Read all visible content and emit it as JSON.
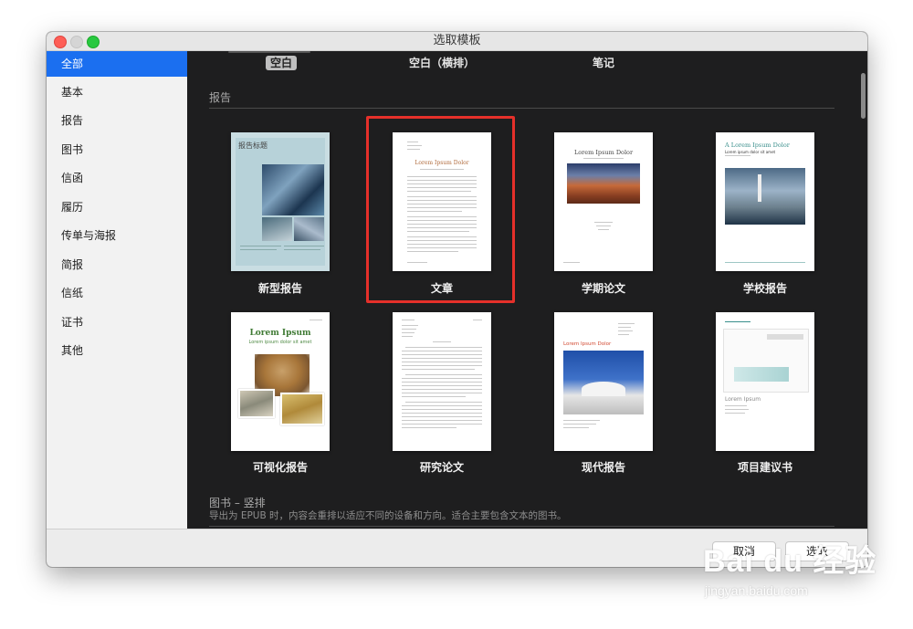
{
  "window": {
    "title": "选取模板"
  },
  "sidebar": {
    "items": [
      {
        "label": "全部",
        "active": true
      },
      {
        "label": "基本"
      },
      {
        "label": "报告"
      },
      {
        "label": "图书"
      },
      {
        "label": "信函"
      },
      {
        "label": "履历"
      },
      {
        "label": "传单与海报"
      },
      {
        "label": "简报"
      },
      {
        "label": "信纸"
      },
      {
        "label": "证书"
      },
      {
        "label": "其他"
      }
    ]
  },
  "top_templates": [
    {
      "label": "空白",
      "selected": true
    },
    {
      "label": "空白（横排）"
    },
    {
      "label": "笔记"
    }
  ],
  "sections": {
    "report": {
      "title": "报告"
    },
    "book_vertical": {
      "title": "图书 – 竖排",
      "description": "导出为 EPUB 时，内容会重排以适应不同的设备和方向。适合主要包含文本的图书。"
    }
  },
  "templates": [
    {
      "label": "新型报告",
      "thumb_title": "报告标题"
    },
    {
      "label": "文章",
      "thumb_title": "Lorem Ipsum Dolor",
      "highlighted": true
    },
    {
      "label": "学期论文",
      "thumb_title": "Lorem Ipsum Dolor"
    },
    {
      "label": "学校报告",
      "thumb_title": "A Lorem Ipsum Dolor",
      "thumb_subtitle": "Lorem ipsum dolor sit amet"
    },
    {
      "label": "可视化报告",
      "thumb_title": "Lorem Ipsum",
      "thumb_subtitle": "Lorem ipsum dolor sit amet"
    },
    {
      "label": "研究论文"
    },
    {
      "label": "现代报告",
      "thumb_title": "Lorem Ipsum Dolor"
    },
    {
      "label": "项目建议书",
      "thumb_title": "Lorem Ipsum"
    }
  ],
  "buttons": {
    "cancel": "取消",
    "choose": "选取"
  },
  "watermark": {
    "brand": "Bai du 经验",
    "url": "jingyan.baidu.com"
  },
  "colors": {
    "accent": "#1b6ff0",
    "highlight": "#e5302a"
  }
}
